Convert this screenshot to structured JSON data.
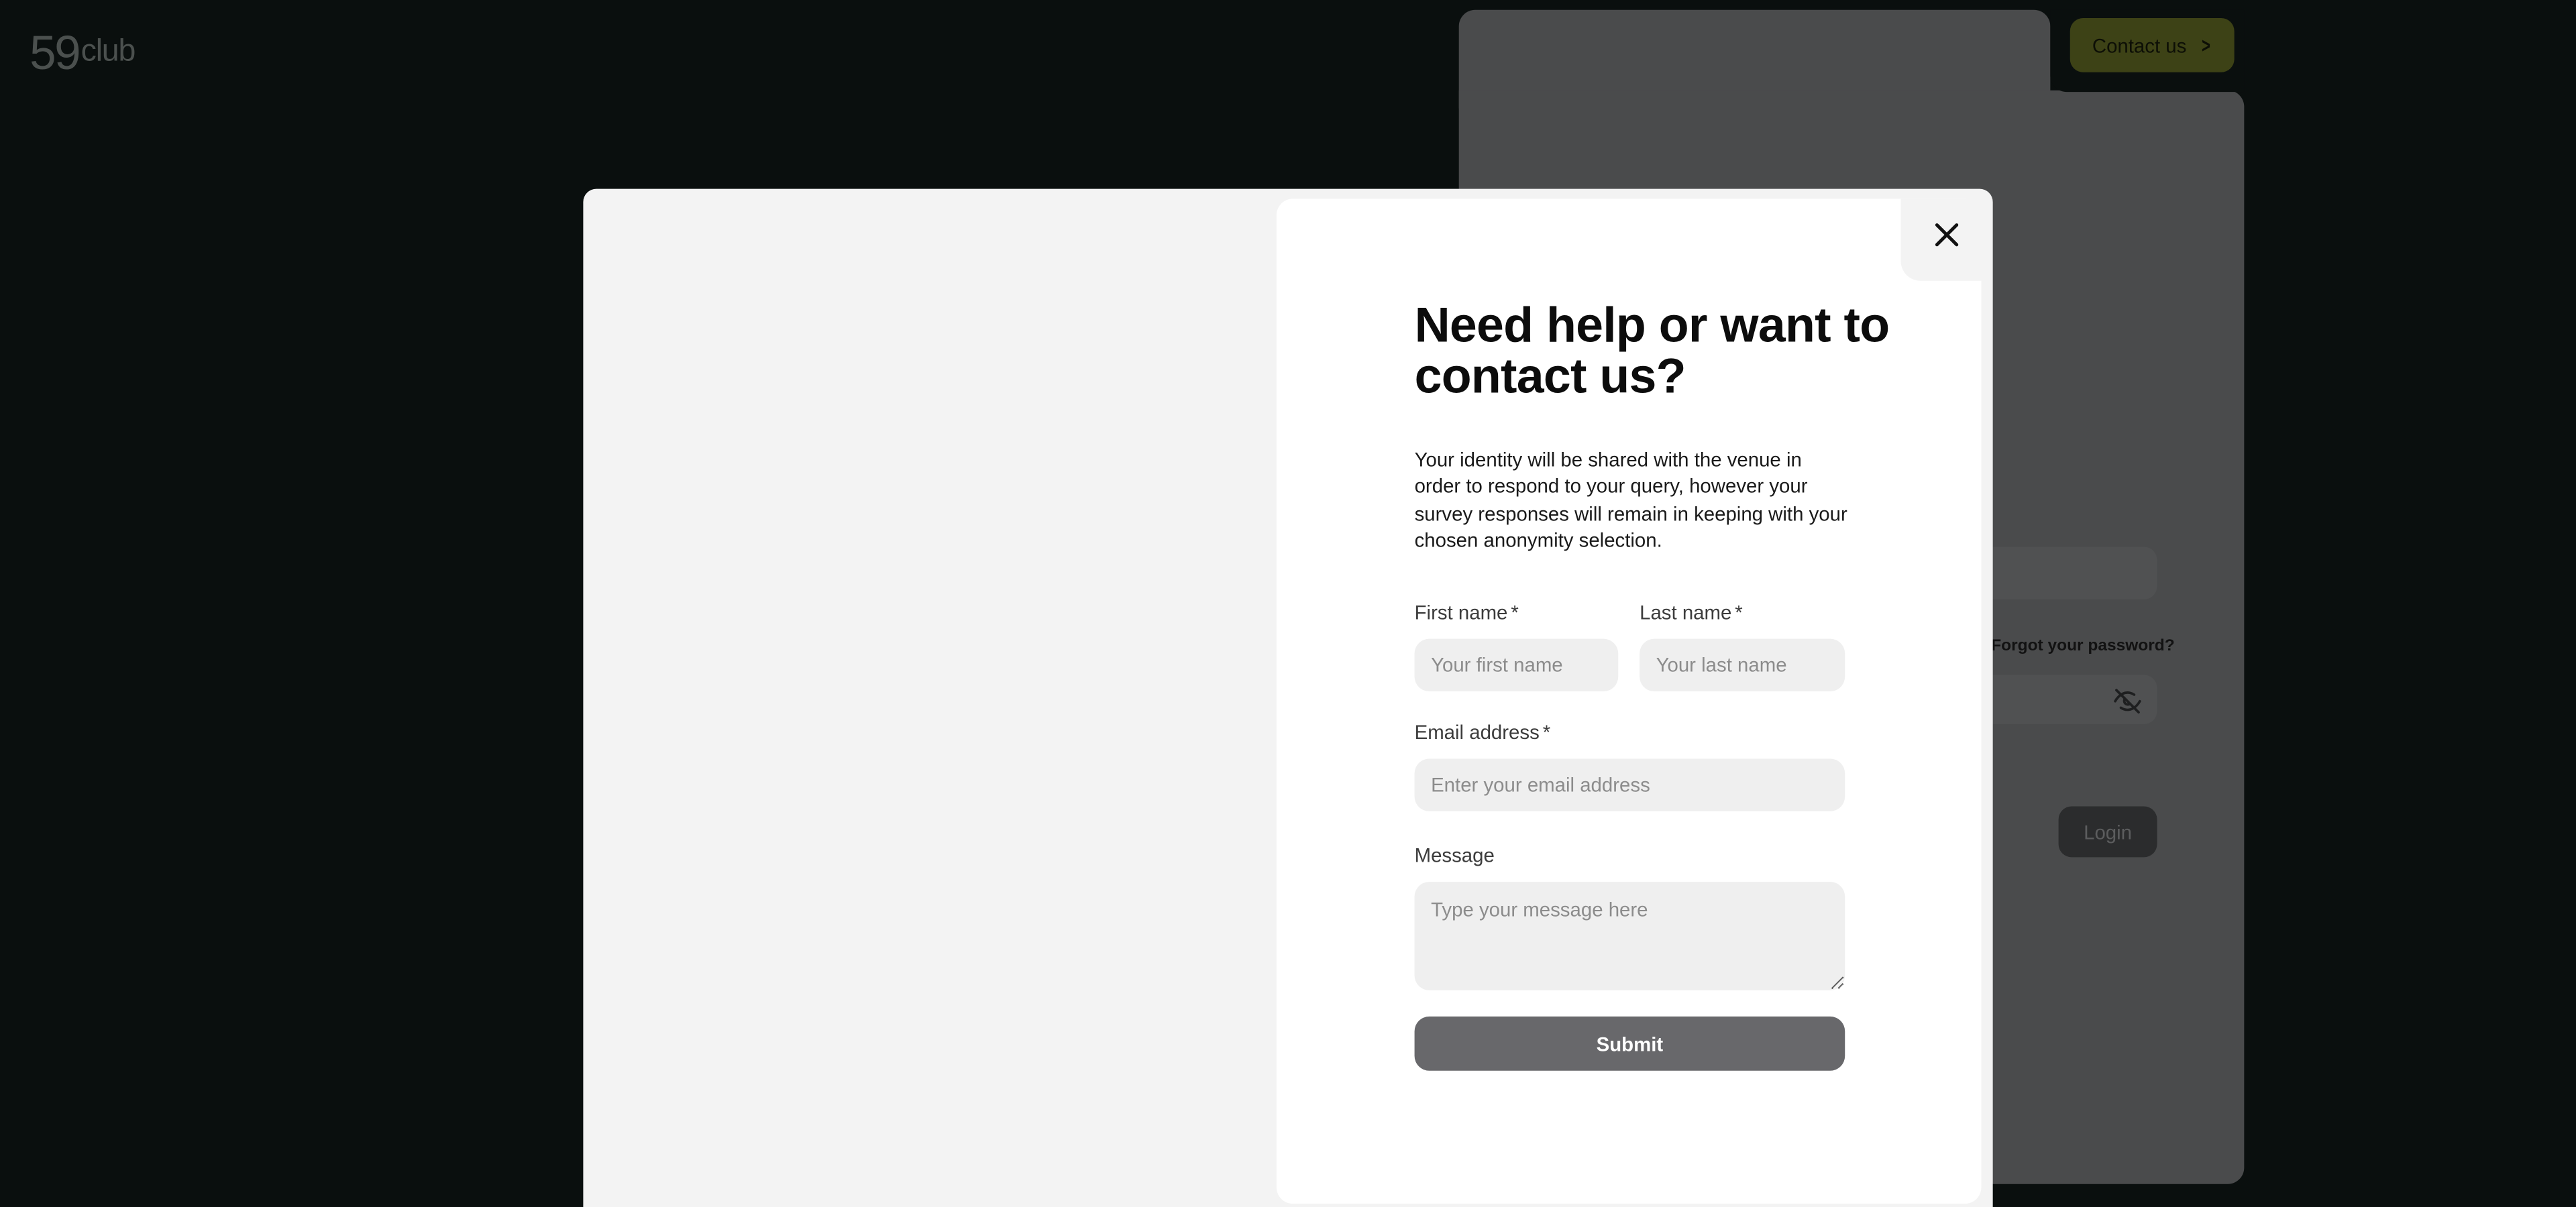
{
  "brand": {
    "logo_mark": "59",
    "logo_word": "club"
  },
  "background": {
    "contact_button_label": "Contact us",
    "forgot_password_link": "Forgot your password?",
    "login_button_label": "Login"
  },
  "modal": {
    "title": "Need help or want to contact us?",
    "description": "Your identity will be shared with the venue in order to respond to your query, however your survey responses will remain in keeping with your chosen anonymity selection.",
    "required_marker": "*",
    "fields": {
      "first_name": {
        "label": "First name",
        "placeholder": "Your first name",
        "value": ""
      },
      "last_name": {
        "label": "Last name",
        "placeholder": "Your last name",
        "value": ""
      },
      "email": {
        "label": "Email address",
        "placeholder": "Enter your email address",
        "value": ""
      },
      "message": {
        "label": "Message",
        "placeholder": "Type your message here",
        "value": ""
      }
    },
    "submit_label": "Submit"
  },
  "icons": {
    "close": "close-icon",
    "contact_chevron": "chevron-right-icon",
    "password_toggle": "eye-off-icon"
  },
  "colors": {
    "page_background": "#0a0f0e",
    "accent_button": "#3d4216",
    "submit_button": "#68686b",
    "modal_background": "#f3f3f3",
    "panel_background": "#ffffff"
  }
}
